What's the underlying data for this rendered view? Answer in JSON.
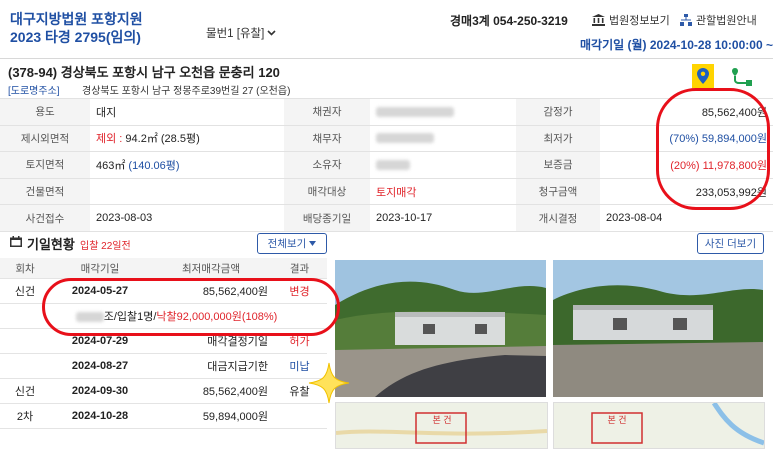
{
  "header": {
    "court_name": "대구지방법원 포항지원",
    "case_number": "2023 타경 2795(임의)",
    "item_select": "물번1 [유찰]",
    "phone": "경매3계 054-250-3219",
    "link_court_info": "법원정보보기",
    "link_jurisdiction": "관할법원안내",
    "auction_date": "매각기일 (월) 2024-10-28 10:00:00 ~"
  },
  "address": {
    "lot": "(378-94) 경상북도 포항시 남구 오천읍 문충리 120",
    "road_tag": "[도로명주소]",
    "road": "경상북도 포항시 남구 정몽주로39번길 27 (오천읍)"
  },
  "info": {
    "rows": [
      {
        "l1": "용도",
        "v1": "대지",
        "l2": "채권자",
        "l3": "감정가",
        "v3": "85,562,400원"
      },
      {
        "l1": "제시외면적",
        "v1a": "제외 : ",
        "v1b": "94.2㎡ (28.5평)",
        "l2": "채무자",
        "l3": "최저가",
        "v3": "(70%) 59,894,000원"
      },
      {
        "l1": "토지면적",
        "v1a": "463㎡ ",
        "v1b": "(140.06평)",
        "l2": "소유자",
        "l3": "보증금",
        "v3": "(20%) 11,978,800원"
      },
      {
        "l1": "건물면적",
        "v1": "",
        "l2": "매각대상",
        "v2": "토지매각",
        "l3": "청구금액",
        "v3": "233,053,992원"
      },
      {
        "l1": "사건접수",
        "v1": "2023-08-03",
        "l2": "배당종기일",
        "v2": "2023-10-17",
        "l3": "개시결정",
        "v3": "2023-08-04"
      }
    ]
  },
  "history": {
    "title": "기일현황",
    "subtitle": "입찰 22일전",
    "btn_all": "전체보기",
    "btn_photo": "사진 더보기",
    "headers": [
      "회차",
      "매각기일",
      "최저매각금액",
      "결과"
    ],
    "rows": [
      {
        "round": "신건",
        "date": "2024-05-27",
        "amount": "85,562,400원",
        "result": "변경"
      },
      {
        "date": "2024-07-29",
        "amount": "매각결정기일",
        "result": "허가"
      },
      {
        "date": "2024-08-27",
        "amount": "대금지급기한",
        "result": "미납"
      },
      {
        "round": "신건",
        "date": "2024-09-30",
        "amount": "85,562,400원",
        "result": "유찰"
      },
      {
        "round": "2차",
        "date": "2024-10-28",
        "amount": "59,894,000원",
        "result": ""
      }
    ],
    "bid_suffix": "조/입찰1명/",
    "bid_won": "낙찰92,000,000원(108%)"
  },
  "maps": {
    "label1": "본 건",
    "label2": "본 건"
  },
  "colors": {
    "accent": "#1f4fa3",
    "red": "#e0242b",
    "highlight": "#ffd400"
  }
}
